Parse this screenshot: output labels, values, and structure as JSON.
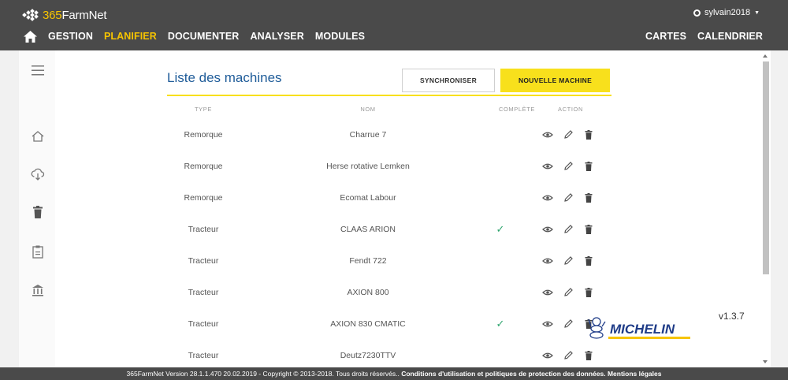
{
  "app": {
    "logo_prefix": "365",
    "logo_suffix": "FarmNet",
    "user": "sylvain2018"
  },
  "nav": {
    "left": [
      "GESTION",
      "PLANIFIER",
      "DOCUMENTER",
      "ANALYSER",
      "MODULES"
    ],
    "right": [
      "CARTES",
      "CALENDRIER"
    ],
    "active": "PLANIFIER"
  },
  "page": {
    "title": "Liste des machines",
    "sync_label": "SYNCHRONISER",
    "new_label": "NOUVELLE MACHINE",
    "columns": {
      "type": "TYPE",
      "nom": "NOM",
      "complete": "COMPLÈTE",
      "action": "ACTION"
    }
  },
  "machines": [
    {
      "type": "Remorque",
      "nom": "Charrue 7",
      "complete": false
    },
    {
      "type": "Remorque",
      "nom": "Herse rotative Lemken",
      "complete": false
    },
    {
      "type": "Remorque",
      "nom": "Ecomat Labour",
      "complete": false
    },
    {
      "type": "Tracteur",
      "nom": "CLAAS ARION",
      "complete": true
    },
    {
      "type": "Tracteur",
      "nom": "Fendt 722",
      "complete": false
    },
    {
      "type": "Tracteur",
      "nom": "AXION 800",
      "complete": false
    },
    {
      "type": "Tracteur",
      "nom": "AXION 830 CMATIC",
      "complete": true
    },
    {
      "type": "Tracteur",
      "nom": "Deutz7230TTV",
      "complete": false
    }
  ],
  "branding": {
    "version": "v1.3.7",
    "michelin_text": "MICHELIN"
  },
  "footer": {
    "text": "365FarmNet Version 28.1.1.470 20.02.2019 - Copyright © 2013-2018. Tous droits réservés.. ",
    "links": "Conditions d'utilisation et politiques de protection des données. Mentions légales"
  },
  "colors": {
    "accent": "#f6c400",
    "yellow_button": "#f8e01c",
    "title_blue": "#1f5c99",
    "check_green": "#2ea56e",
    "bar": "#4a4a4a"
  }
}
